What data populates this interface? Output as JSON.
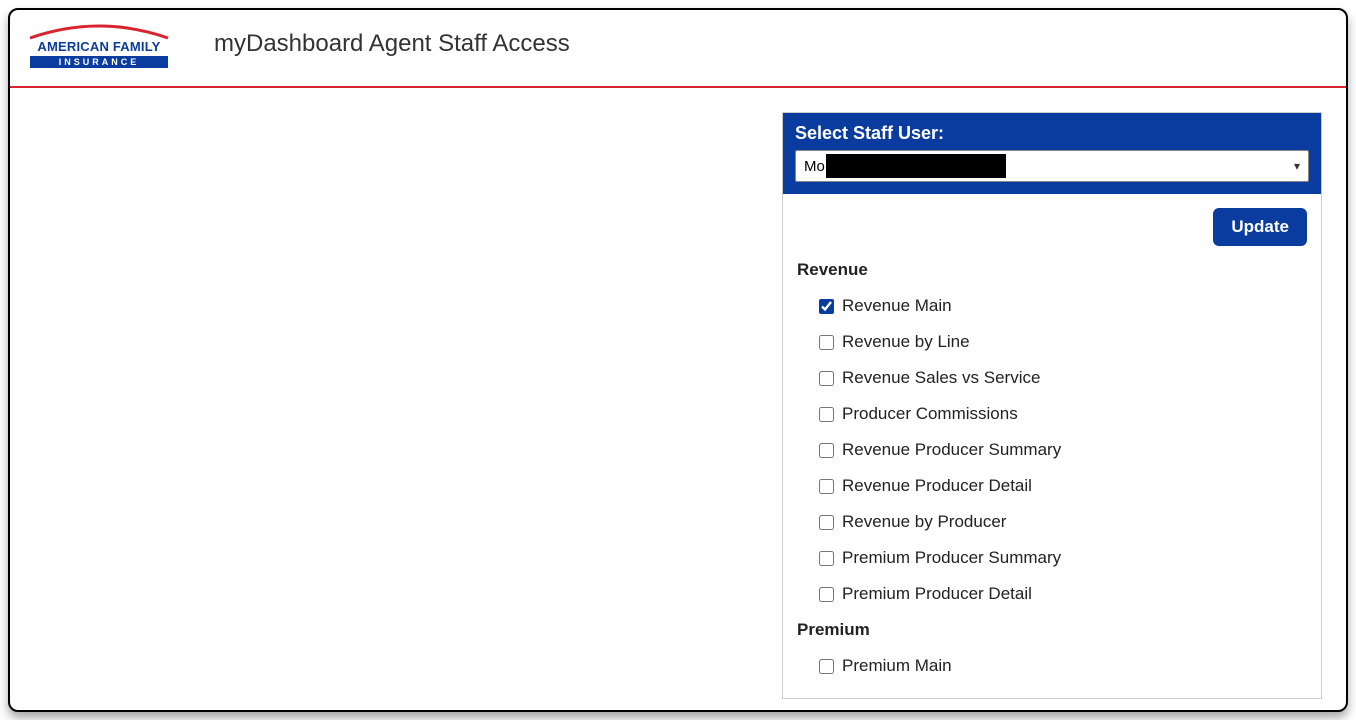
{
  "header": {
    "title": "myDashboard Agent Staff Access",
    "logo_top": "AMERICAN FAMILY",
    "logo_bottom": "INSURANCE"
  },
  "panel": {
    "select_label": "Select Staff User:",
    "selected_user_visible": "Mo",
    "update_label": "Update"
  },
  "sections": [
    {
      "title": "Revenue",
      "items": [
        {
          "label": "Revenue Main",
          "checked": true
        },
        {
          "label": "Revenue by Line",
          "checked": false
        },
        {
          "label": "Revenue Sales vs Service",
          "checked": false
        },
        {
          "label": "Producer Commissions",
          "checked": false
        },
        {
          "label": "Revenue Producer Summary",
          "checked": false
        },
        {
          "label": "Revenue Producer Detail",
          "checked": false
        },
        {
          "label": "Revenue by Producer",
          "checked": false
        },
        {
          "label": "Premium Producer Summary",
          "checked": false
        },
        {
          "label": "Premium Producer Detail",
          "checked": false
        }
      ]
    },
    {
      "title": "Premium",
      "items": [
        {
          "label": "Premium Main",
          "checked": false
        }
      ]
    }
  ]
}
